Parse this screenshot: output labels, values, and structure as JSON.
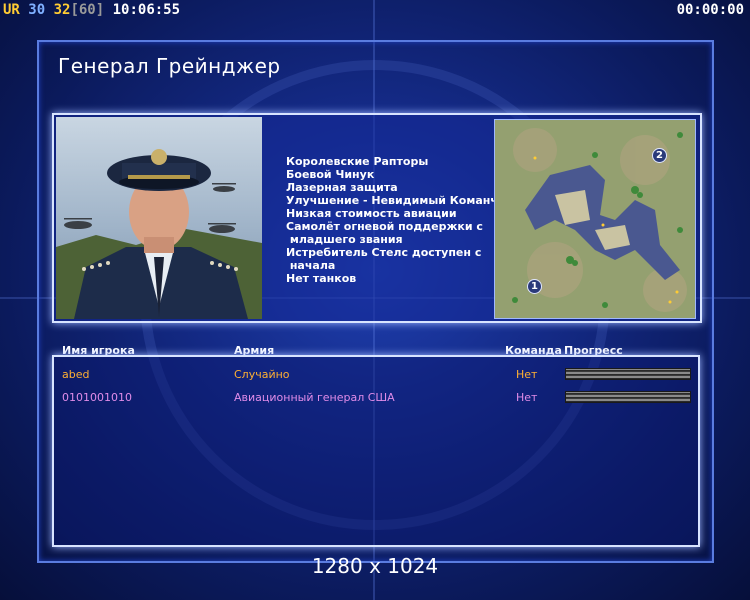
{
  "hud": {
    "ur_label": "UR",
    "players_count": "30",
    "fps": "32",
    "fps_max": "[60]",
    "time": "10:06:55",
    "match_timer": "00:00:00"
  },
  "general": {
    "title": "Генерал Грейнджер",
    "perks": [
      "Королевские Рапторы",
      "Боевой Чинук",
      "Лазерная защита",
      "Улучшение - Невидимый Команч",
      "Низкая стоимость авиации",
      "Самолёт огневой поддержки с",
      " младшего звания",
      "Истребитель Стелс доступен с",
      " начала",
      "Нет танков"
    ]
  },
  "minimap": {
    "markers": [
      "1",
      "2"
    ]
  },
  "table": {
    "headers": {
      "player": "Имя игрока",
      "army": "Армия",
      "team": "Команда",
      "progress": "Прогресс"
    },
    "rows": [
      {
        "name": "abed",
        "army": "Случайно",
        "team": "Нет",
        "color": "#ffb033"
      },
      {
        "name": "0101001010",
        "army": "Авиационный генерал США",
        "team": "Нет",
        "color": "#e08ce8"
      }
    ]
  },
  "resolution": "1280 x 1024"
}
